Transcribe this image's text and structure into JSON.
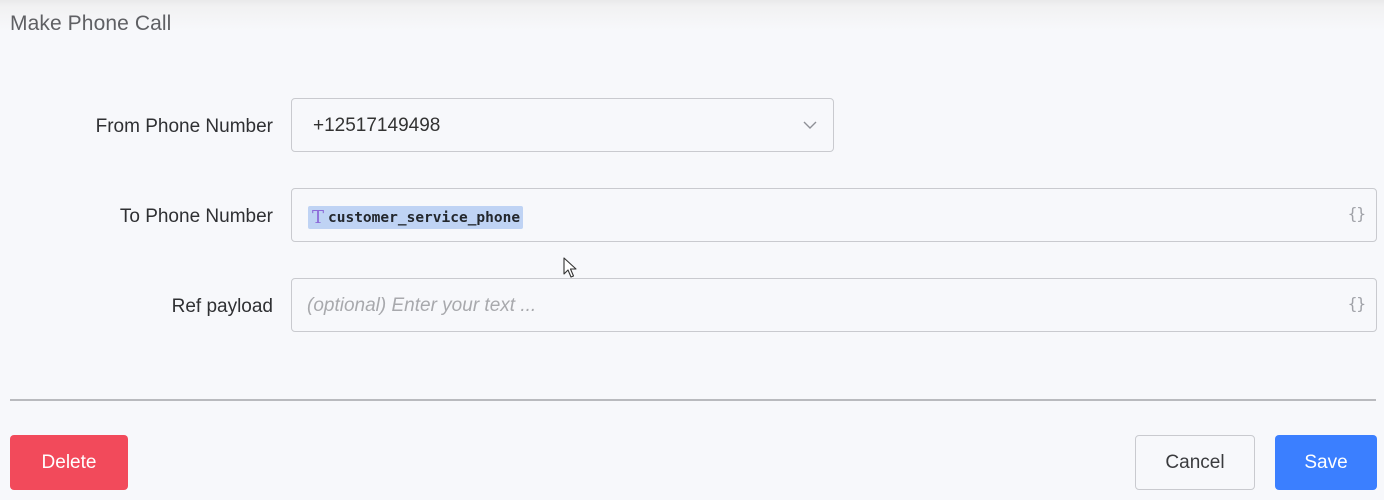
{
  "dialog": {
    "title": "Make Phone Call"
  },
  "form": {
    "from_phone": {
      "label": "From Phone Number",
      "value": "+12517149498",
      "icon": "chevron-down-icon"
    },
    "to_phone": {
      "label": "To Phone Number",
      "token_icon": "text-type-icon",
      "token_icon_glyph": "T",
      "token_value": "customer_service_phone",
      "variable_icon": "curly-braces-icon",
      "variable_glyph": "{}"
    },
    "ref_payload": {
      "label": "Ref payload",
      "placeholder": "(optional) Enter your text ...",
      "variable_icon": "curly-braces-icon",
      "variable_glyph": "{}"
    }
  },
  "actions": {
    "delete_label": "Delete",
    "cancel_label": "Cancel",
    "save_label": "Save"
  },
  "colors": {
    "delete": "#f24a5b",
    "save": "#3b7fff",
    "token_highlight": "#bfd3f4",
    "token_icon": "#8c6ad8"
  }
}
